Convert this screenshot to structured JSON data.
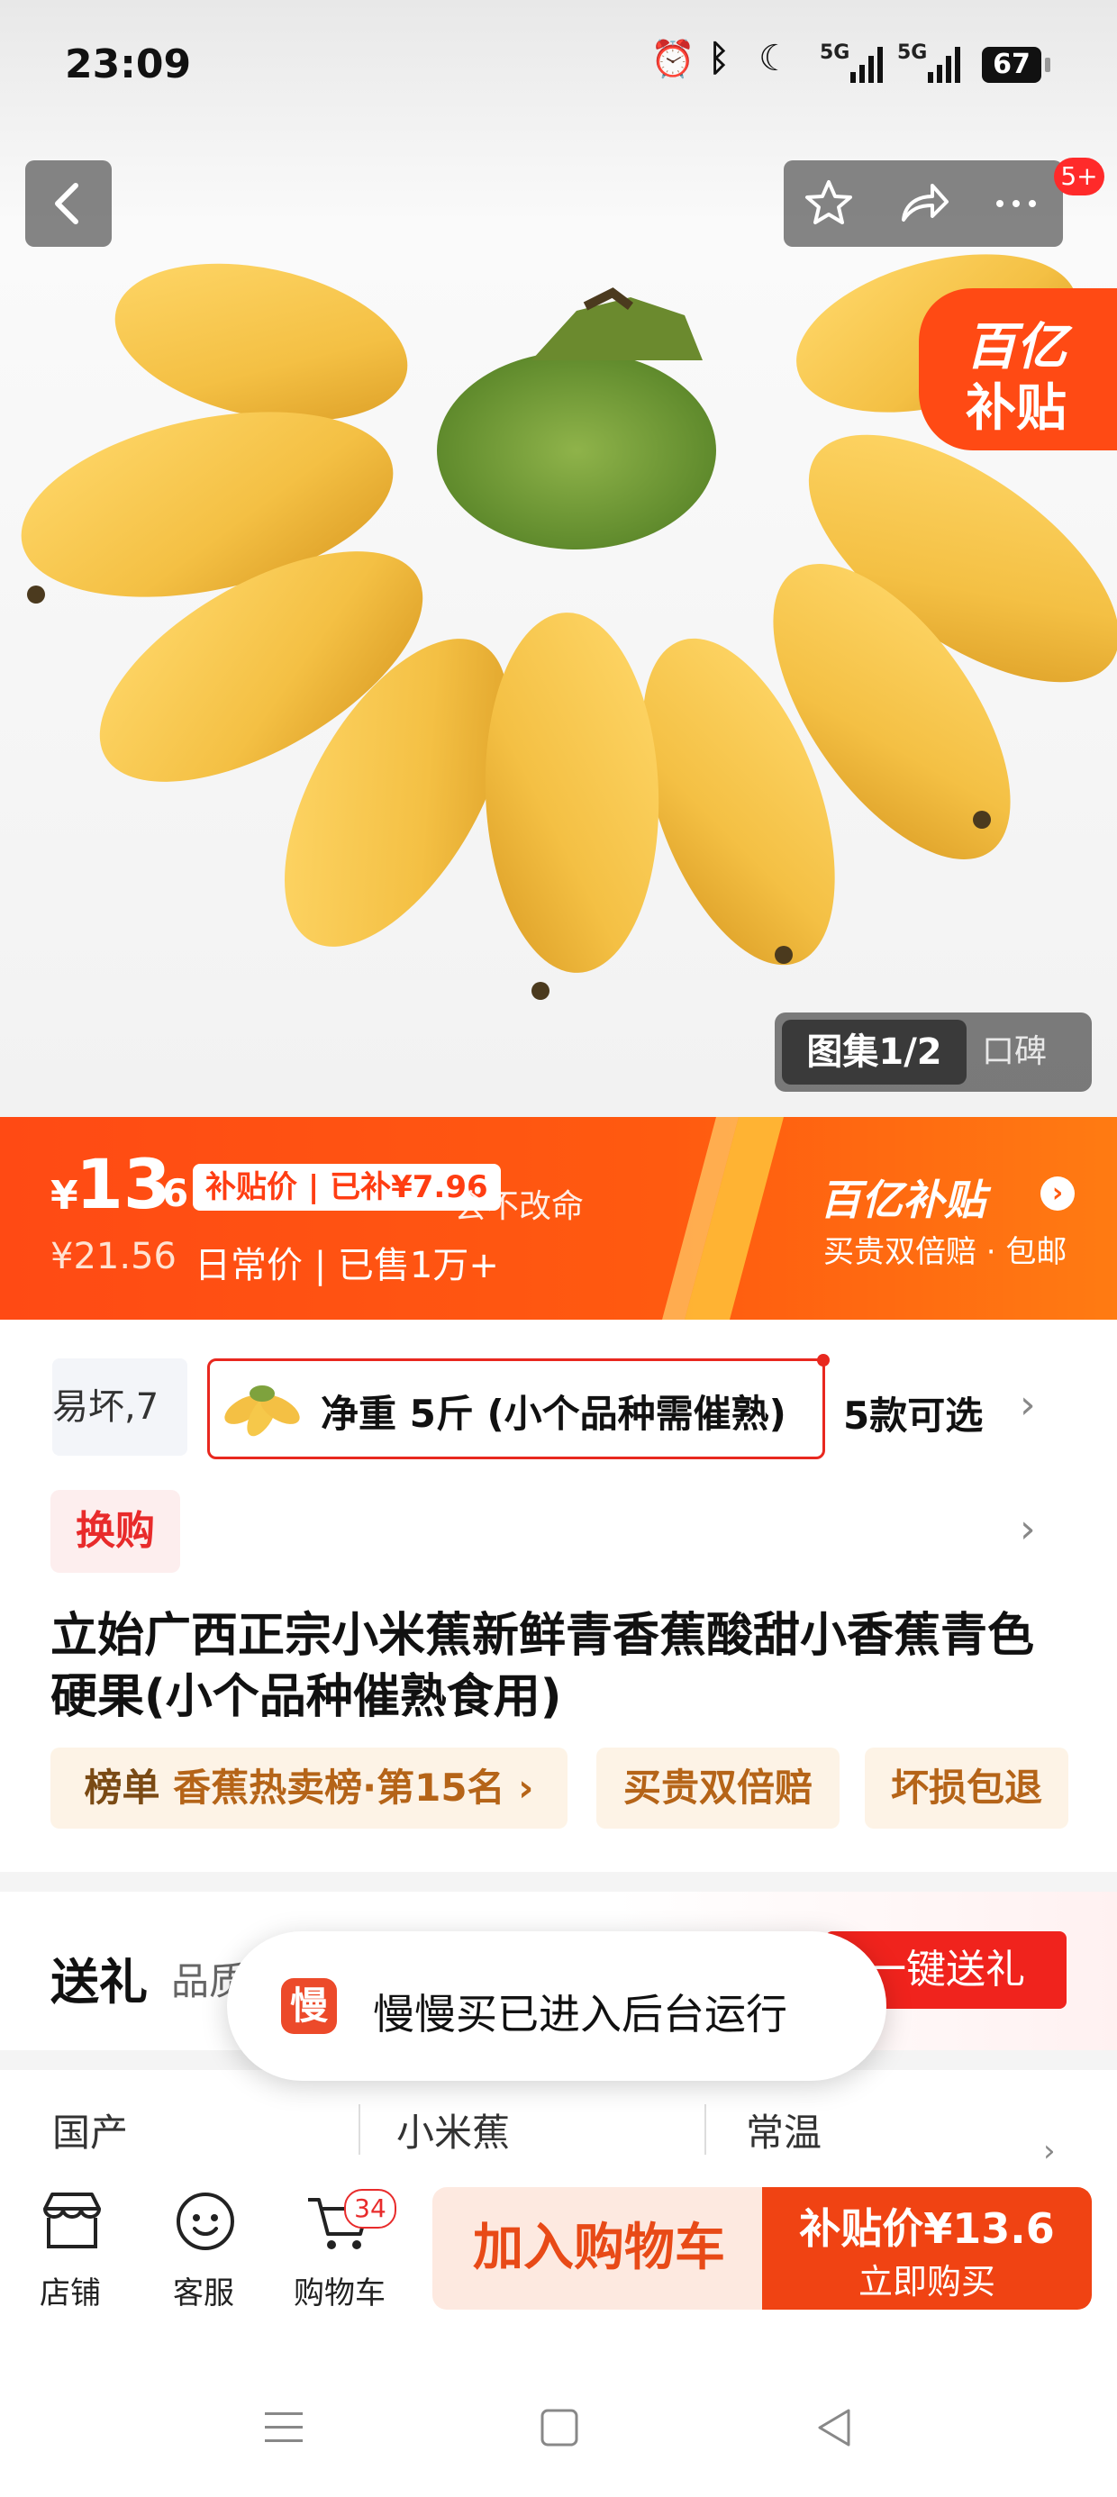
{
  "status_bar": {
    "time": "23:09",
    "battery": "67",
    "signal1": "5G",
    "signal2": "5G"
  },
  "hero": {
    "badge_count": "5+",
    "subsidy_corner": {
      "line1": "百亿",
      "line2": "补贴"
    },
    "gallery_current": "图集1/2",
    "gallery_other": "口碑"
  },
  "price": {
    "currency": "¥",
    "integer": "13",
    "decimal": ".6",
    "subsidy_tag": "补贴价 | 已补¥7.96",
    "overlay_text": "会不改命",
    "original": "¥21.56",
    "sold_line": "日常价 | 已售1万+",
    "brand_logo": "百亿补贴",
    "brand_sub": "买贵双倍赔 · 包邮"
  },
  "sku": {
    "prev_label": "易坏,7",
    "selected_label": "净重 5斤 (小个品种需催熟)",
    "count_label": "5款可选"
  },
  "swap_tag": "换购",
  "title": "立始广西正宗小米蕉新鲜青香蕉酸甜小香蕉青色硬果(小个品种催熟食用)",
  "tags": {
    "rank_prefix": "榜单",
    "rank": "香蕉热卖榜·第15名",
    "tag2": "买贵双倍赔",
    "tag3": "坏损包退"
  },
  "gift": {
    "label": "送礼",
    "sub": "品质",
    "button": "一键送礼"
  },
  "toast": {
    "icon": "慢",
    "text": "慢慢买已进入后台运行"
  },
  "attributes": [
    "国产",
    "小米蕉",
    "常温"
  ],
  "bottom_bar": {
    "store": "店铺",
    "service": "客服",
    "cart": "购物车",
    "cart_count": "34",
    "add_cart": "加入购物车",
    "buy_price": "补贴价¥13.6",
    "buy_label": "立即购买"
  },
  "colors": {
    "accent": "#ff4a14",
    "red": "#e82b2b",
    "tag_text": "#b56418"
  }
}
